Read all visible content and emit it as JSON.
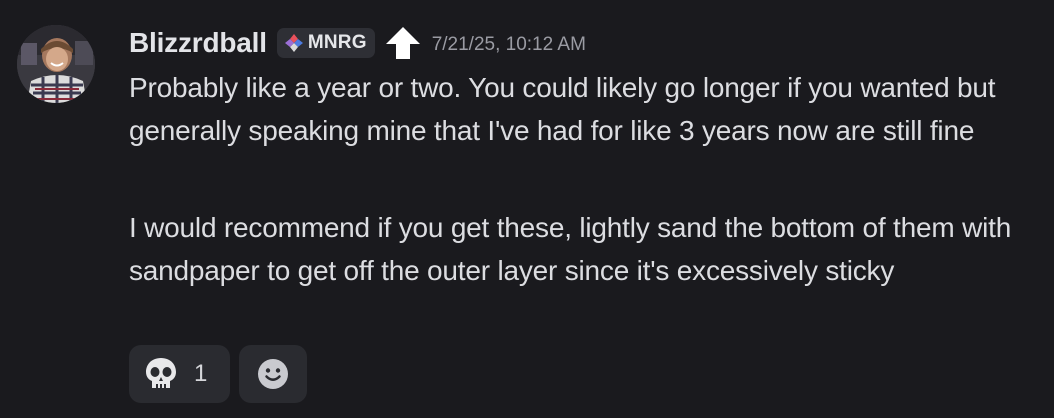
{
  "message": {
    "author": {
      "username": "Blizzrdball",
      "avatar_icon": "avatar-photo",
      "tag": {
        "label": "MNRG",
        "icon": "diamond-tag-icon"
      },
      "role_icon": "up-arrow-icon"
    },
    "timestamp": "7/21/25, 10:12 AM",
    "paragraphs": [
      "Probably like a year or two. You could likely go longer if you wanted but generally speaking mine that I've had for like 3 years now are still fine",
      "I would recommend if you get these, lightly sand the bottom of them with sandpaper to get off the outer layer since it's excessively sticky"
    ],
    "reactions": [
      {
        "emoji": "skull-icon",
        "count": "1"
      }
    ],
    "add_reaction_icon": "smiley-add-reaction-icon"
  },
  "colors": {
    "background": "#1a1a1e",
    "text": "#dcdde1",
    "timestamp": "#9a9ba3",
    "tag_bg": "#2e2f35",
    "reaction_bg": "#2a2b30"
  }
}
